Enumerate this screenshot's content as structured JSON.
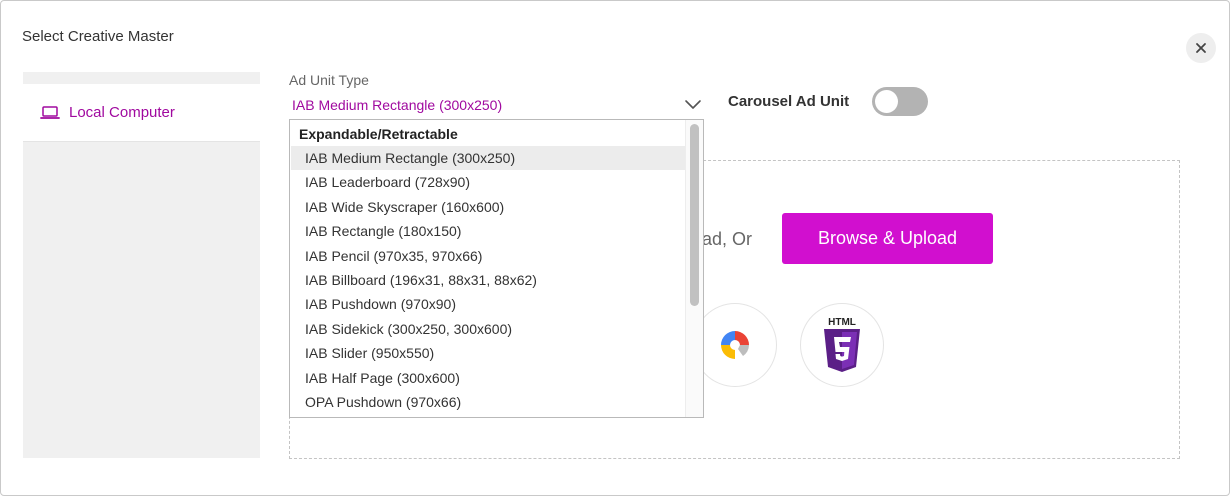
{
  "dialog": {
    "title": "Select Creative Master",
    "close_icon": "close-icon"
  },
  "sidebar": {
    "items": [
      {
        "label": "Local Computer",
        "icon": "laptop-icon"
      }
    ]
  },
  "form": {
    "ad_unit_type_label": "Ad Unit Type",
    "ad_unit_type_value": "IAB Medium Rectangle (300x250)",
    "carousel_label": "Carousel Ad Unit",
    "carousel_on": false
  },
  "dropdown": {
    "group": "Expandable/Retractable",
    "selected_index": 0,
    "options": [
      "IAB Medium Rectangle (300x250)",
      "IAB Leaderboard (728x90)",
      "IAB Wide Skyscraper (160x600)",
      "IAB Rectangle (180x150)",
      "IAB Pencil (970x35, 970x66)",
      "IAB Billboard (196x31, 88x31, 88x62)",
      "IAB Pushdown (970x90)",
      "IAB Sidekick (300x250, 300x600)",
      "IAB Slider (950x550)",
      "IAB Half Page (300x600)",
      "OPA Pushdown (970x66)"
    ]
  },
  "upload": {
    "partial_text": "oad, Or",
    "browse_label": "Browse & Upload",
    "sources": [
      {
        "icon": "google-web-designer-icon"
      },
      {
        "icon": "html5-icon",
        "label": "HTML"
      }
    ]
  },
  "colors": {
    "accent": "#a0099f",
    "button": "#d10fcf",
    "toggle_off": "#b3b3b3"
  }
}
